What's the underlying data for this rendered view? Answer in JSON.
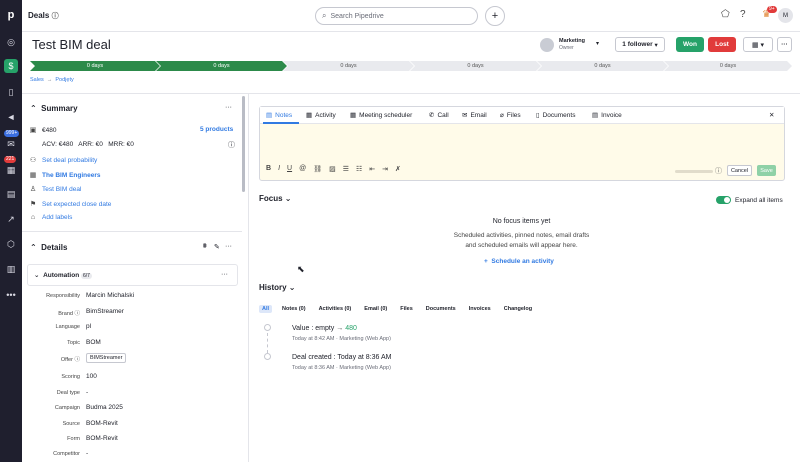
{
  "topbar": {
    "title": "Deals",
    "search_placeholder": "Search Pipedrive",
    "notif_count": "9+",
    "avatar": "M"
  },
  "rail": {
    "logo": "p",
    "badges": [
      "999+",
      "221"
    ]
  },
  "deal": {
    "title": "Test BIM deal",
    "owner_name": "Marketing",
    "owner_role": "Owner",
    "follower_label": "1 follower",
    "won_label": "Won",
    "lost_label": "Lost"
  },
  "pipeline": {
    "stages": [
      {
        "label": "0 days",
        "active": true
      },
      {
        "label": "0 days",
        "active": true
      },
      {
        "label": "0 days",
        "active": false
      },
      {
        "label": "0 days",
        "active": false
      },
      {
        "label": "0 days",
        "active": false
      },
      {
        "label": "0 days",
        "active": false
      }
    ]
  },
  "breadcrumb": {
    "items": [
      "Sales",
      "Podjęty"
    ],
    "separator": "→"
  },
  "summary": {
    "title": "Summary",
    "amount": "€480",
    "products": "5 products",
    "metrics": "ACV: €480   ARR: €0   MRR: €0",
    "set_probability": "Set deal probability",
    "organization": "The BIM Engineers",
    "person": "Test BIM deal",
    "close_date": "Set expected close date",
    "add_labels": "Add labels"
  },
  "details": {
    "title": "Details",
    "automation_title": "Automation",
    "automation_count": "6/7",
    "fields": [
      {
        "label": "Responsibility",
        "value": "Marcin Michalski",
        "info": false
      },
      {
        "label": "Brand",
        "value": "BimStreamer",
        "info": true
      },
      {
        "label": "Language",
        "value": "pl",
        "info": false
      },
      {
        "label": "Topic",
        "value": "BOM",
        "info": false
      },
      {
        "label": "Offer",
        "value": "BIMStreamer",
        "info": true
      },
      {
        "label": "Scoring",
        "value": "100",
        "info": false
      },
      {
        "label": "Deal type",
        "value": "-",
        "info": false
      },
      {
        "label": "Campaign",
        "value": "Budma 2025",
        "info": false
      },
      {
        "label": "Source",
        "value": "BOM-Revit",
        "info": false
      },
      {
        "label": "Form",
        "value": "BOM-Revit",
        "info": false
      },
      {
        "label": "Competitor",
        "value": "-",
        "info": false
      }
    ]
  },
  "composer": {
    "tabs": [
      "Notes",
      "Activity",
      "Meeting scheduler",
      "Call",
      "Email",
      "Files",
      "Documents",
      "Invoice"
    ],
    "cancel_label": "Cancel",
    "save_label": "Save"
  },
  "focus": {
    "title": "Focus",
    "expand_label": "Expand all items",
    "empty_title": "No focus items yet",
    "empty_line1": "Scheduled activities, pinned notes, email drafts",
    "empty_line2": "and scheduled emails will appear here.",
    "schedule_label": "Schedule an activity"
  },
  "history": {
    "title": "History",
    "tabs": [
      "All",
      "Notes (0)",
      "Activities (0)",
      "Email (0)",
      "Files",
      "Documents",
      "Invoices",
      "Changelog"
    ],
    "items": [
      {
        "prefix": "Value : empty",
        "arrow": "→",
        "value": "480",
        "meta": "Today at 8:42 AM · Marketing (Web App)"
      },
      {
        "prefix": "Deal created : Today at 8:36 AM",
        "arrow": "",
        "value": "",
        "meta": "Today at 8:36 AM · Marketing (Web App)"
      }
    ]
  },
  "colors": {
    "accent": "#317ae2",
    "won": "#26a269",
    "lost": "#e13b3b",
    "stage_active": "#2c8a4a",
    "stage_inactive": "#e9eaee"
  }
}
